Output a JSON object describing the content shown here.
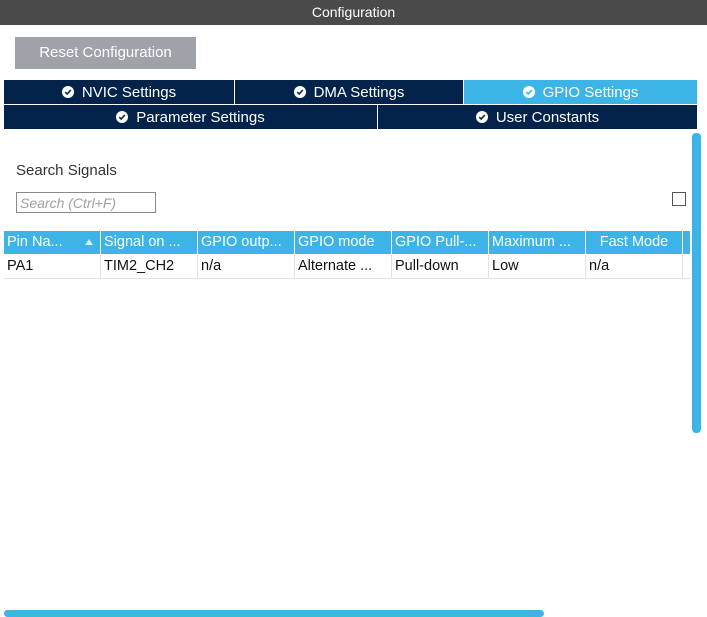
{
  "window": {
    "title": "Configuration"
  },
  "toolbar": {
    "reset_label": "Reset Configuration"
  },
  "tabs_row1": [
    {
      "label": "NVIC Settings",
      "icon": "check-circle-icon",
      "active": false
    },
    {
      "label": "DMA Settings",
      "icon": "check-circle-icon",
      "active": false
    },
    {
      "label": "GPIO Settings",
      "icon": "check-circle-icon",
      "active": true
    }
  ],
  "tabs_row2": [
    {
      "label": "Parameter Settings",
      "icon": "check-circle-icon",
      "active": false
    },
    {
      "label": "User Constants",
      "icon": "check-circle-icon",
      "active": false
    }
  ],
  "search": {
    "label": "Search Signals",
    "placeholder": "Search (Ctrl+F)",
    "value": "",
    "show_modified_checked": false
  },
  "table": {
    "headers": [
      "Pin Na...",
      "Signal on ...",
      "GPIO outp...",
      "GPIO mode",
      "GPIO Pull-...",
      "Maximum ...",
      "Fast Mode"
    ],
    "rows": [
      [
        "PA1",
        "TIM2_CH2",
        "n/a",
        "Alternate ...",
        "Pull-down",
        "Low",
        "n/a"
      ]
    ]
  },
  "colors": {
    "titlebar": "#4a4a4a",
    "tab_inactive": "#03234b",
    "tab_active": "#3cb4e6",
    "header": "#3cb4e6",
    "button": "#9da3a8",
    "scrollbar": "#3cb4e6"
  }
}
